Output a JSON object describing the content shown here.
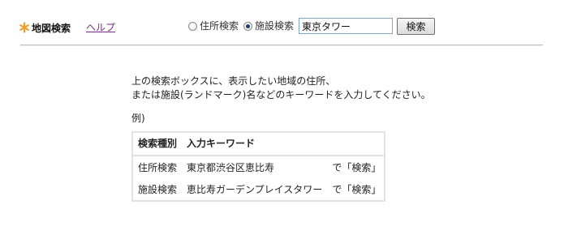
{
  "header": {
    "title": "地図検索",
    "help_label": "ヘルプ",
    "star_icon": "asterisk-icon",
    "accent_color": "#f0a02a",
    "help_link_color": "#7a2a8a"
  },
  "search": {
    "radio_address_label": "住所検索",
    "radio_facility_label": "施設検索",
    "selected": "施設検索",
    "input_value": "東京タワー",
    "button_label": "検索"
  },
  "main": {
    "instruction_line1": "上の検索ボックスに、表示したい地域の住所、",
    "instruction_line2": "または施設(ランドマーク)名などのキーワードを入力してください。",
    "example_label": "例)",
    "table": {
      "headers": [
        "検索種別",
        "入力キーワード"
      ],
      "rows": [
        {
          "type": "住所検索",
          "keyword": "東京都渋谷区恵比寿",
          "action": "で「検索」"
        },
        {
          "type": "施設検索",
          "keyword": "恵比寿ガーデンプレイスタワー",
          "action": "で「検索」"
        }
      ]
    }
  }
}
